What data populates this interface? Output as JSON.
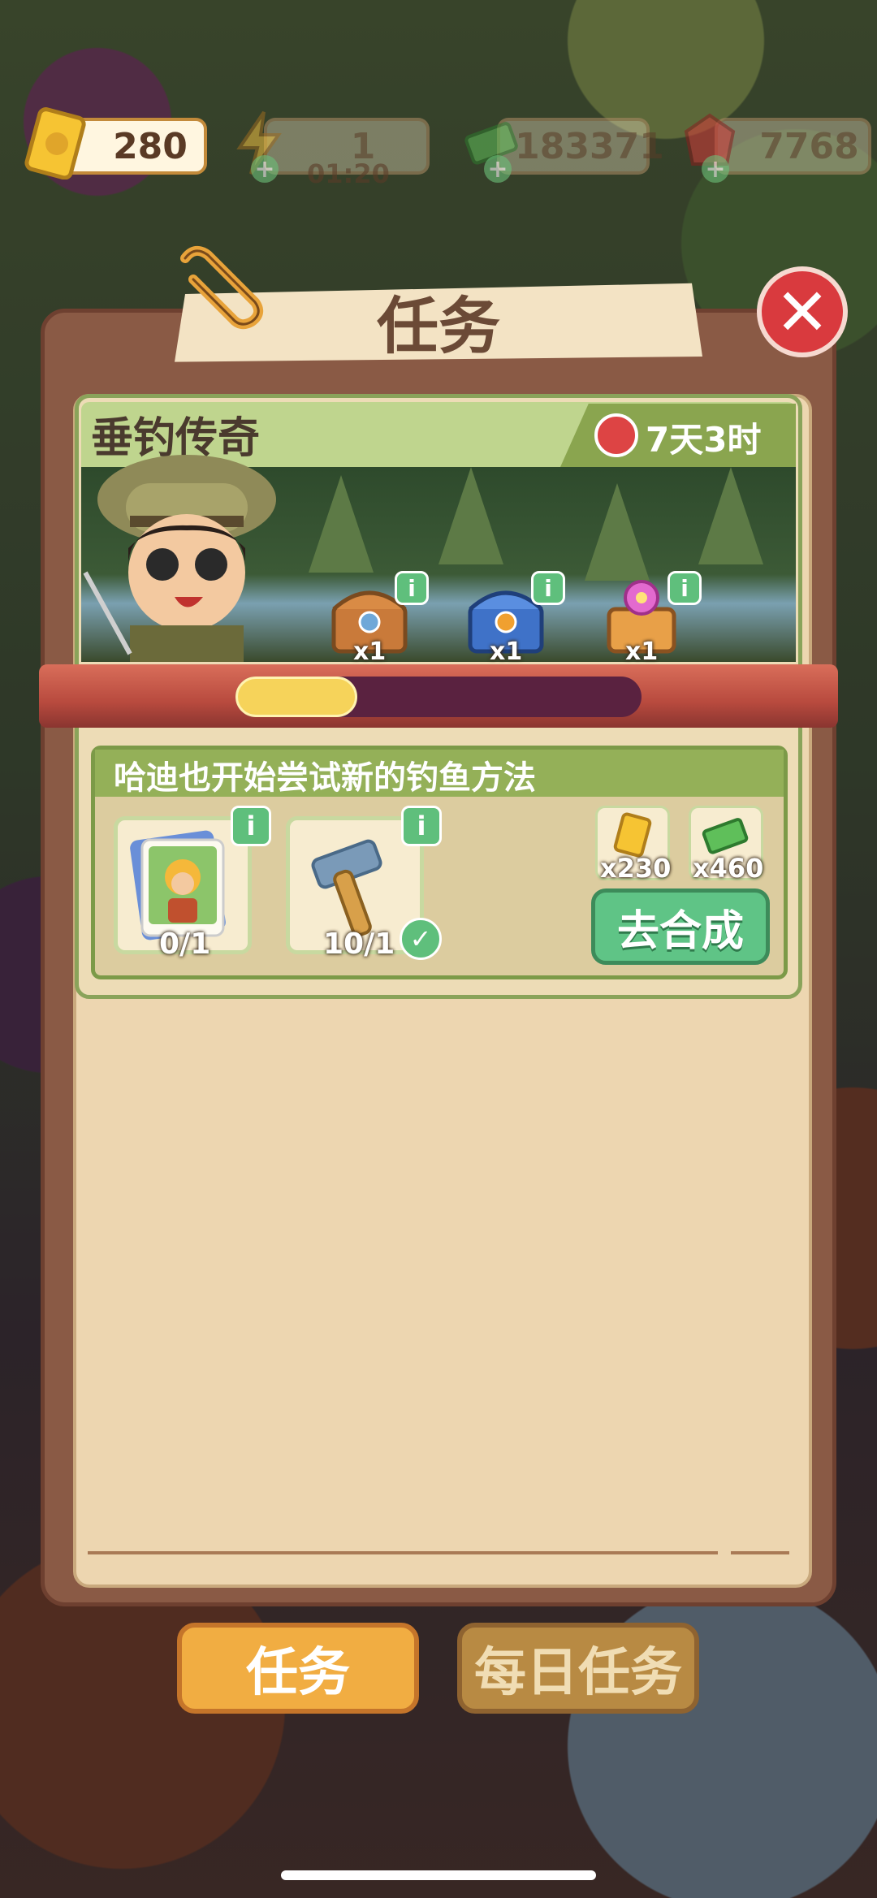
{
  "currency": {
    "tickets": "280",
    "energy": "1",
    "energy_timer": "01:20",
    "cash": "183371",
    "gems": "7768"
  },
  "panel": {
    "title": "任务"
  },
  "quest": {
    "name": "垂钓传奇",
    "time_left": "7天3时",
    "progress": 0.3,
    "rewards": [
      {
        "icon": "wooden-chest-icon",
        "qty": "x1"
      },
      {
        "icon": "blue-chest-icon",
        "qty": "x1"
      },
      {
        "icon": "flower-chest-icon",
        "qty": "x1"
      }
    ]
  },
  "subtask": {
    "title": "哈迪也开始尝试新的钓鱼方法",
    "requirements": [
      {
        "icon": "fisher-card-icon",
        "count": "0/1",
        "done": false
      },
      {
        "icon": "hammer-icon",
        "count": "10/1",
        "done": true
      }
    ],
    "bonus": [
      {
        "icon": "ticket-icon",
        "qty": "x230"
      },
      {
        "icon": "cash-icon",
        "qty": "x460"
      }
    ],
    "go_button": "去合成"
  },
  "tabs": {
    "tasks": "任务",
    "daily": "每日任务"
  },
  "colors": {
    "panel": "#8a5a45",
    "inner": "#edd6b0",
    "green_accent": "#5fc486",
    "active_tab": "#f1ad42",
    "close": "#d93a3e"
  }
}
